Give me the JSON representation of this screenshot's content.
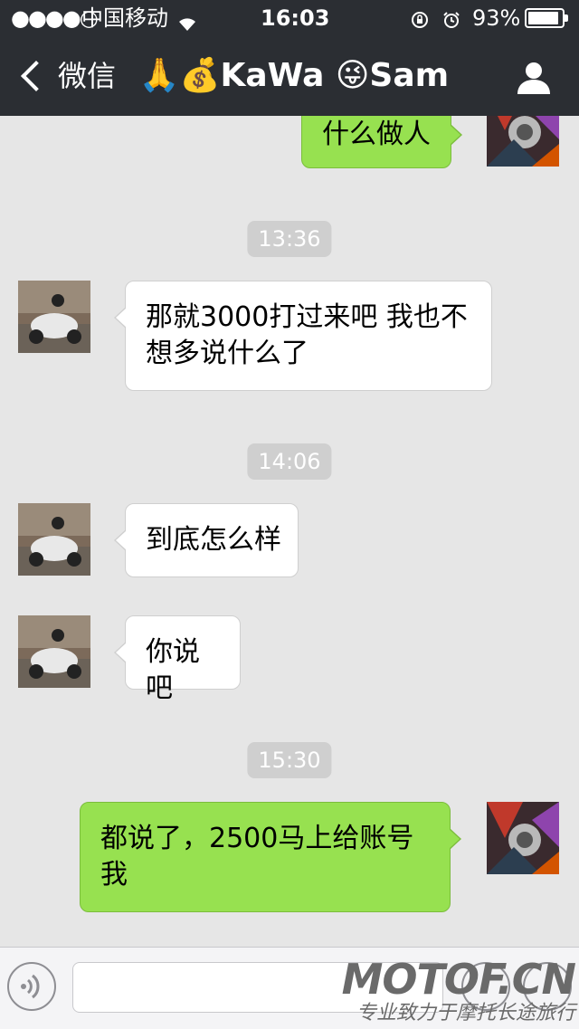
{
  "status_bar": {
    "signal": "●●●●○",
    "carrier": "中国移动",
    "time": "16:03",
    "battery_pct": "93%",
    "battery_level": 0.93
  },
  "nav": {
    "back_label": "微信",
    "title": "🙏💰KaWa 😜Sam"
  },
  "messages": [
    {
      "type": "out",
      "text": "什么做人"
    },
    {
      "type": "time",
      "text": "13:36"
    },
    {
      "type": "in",
      "text": "那就3000打过来吧 我也不想多说什么了"
    },
    {
      "type": "time",
      "text": "14:06"
    },
    {
      "type": "in",
      "text": "到底怎么样"
    },
    {
      "type": "in",
      "text": "你说吧"
    },
    {
      "type": "time",
      "text": "15:30"
    },
    {
      "type": "out",
      "text": "都说了，2500马上给账号我"
    }
  ],
  "watermark": {
    "brand": "MOTOF.CN",
    "slogan": "专业致力于摩托长途旅行"
  },
  "colors": {
    "nav_bg": "#2b2e33",
    "chat_bg": "#e6e6e6",
    "bubble_out": "#97e150",
    "bubble_in": "#ffffff"
  }
}
